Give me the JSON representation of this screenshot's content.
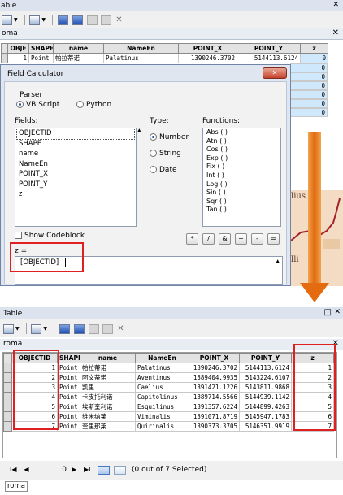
{
  "top_window": {
    "title": "able",
    "toolbar_icons": [
      "table-options-icon",
      "related-tables-icon",
      "select-by-attributes-icon",
      "switch-selection-icon",
      "clear-selection-icon",
      "zoom-to-selected-icon",
      "delete-selected-icon"
    ],
    "tab_label": "oma",
    "close_symbol": "✕",
    "columns": [
      "OBJE",
      "SHAPE",
      "name",
      "NameEn",
      "POINT_X",
      "POINT_Y",
      "z"
    ],
    "first_row": {
      "objectid": "1",
      "shape": "Point",
      "name": "帕拉蒂诺",
      "name_en": "Palatinus",
      "point_x": "1390246.3702",
      "point_y": "5144113.6124",
      "z": "0"
    },
    "z_values": [
      "0",
      "0",
      "0",
      "0",
      "0",
      "0",
      "0"
    ]
  },
  "dialog": {
    "title": "Field Calculator",
    "close_symbol": "✕",
    "parser_label": "Parser",
    "parser_options": [
      "VB Script",
      "Python"
    ],
    "fields_label": "Fields:",
    "fields": [
      "OBJECTID",
      "SHAPE",
      "name",
      "NameEn",
      "POINT_X",
      "POINT_Y",
      "z"
    ],
    "type_label": "Type:",
    "types": [
      "Number",
      "String",
      "Date"
    ],
    "functions_label": "Functions:",
    "functions": [
      "Abs ( )",
      "Atn ( )",
      "Cos ( )",
      "Exp ( )",
      "Fix ( )",
      "Int ( )",
      "Log ( )",
      "Sin ( )",
      "Sqr ( )",
      "Tan ( )"
    ],
    "show_codeblock_label": "Show Codeblock",
    "operators": [
      "*",
      "/",
      "&",
      "+",
      "-",
      "="
    ],
    "expression_label": "z =",
    "expression_value": "[OBJECTID]"
  },
  "map_fragment": {
    "label_1": "lius",
    "label_2": "lli"
  },
  "bottom_window": {
    "title": "Table",
    "window_buttons": [
      "□",
      "✕"
    ],
    "tab_label": "roma",
    "close_symbol": "✕",
    "columns": [
      "OBJECTID",
      "SHAPE",
      "name",
      "NameEn",
      "POINT_X",
      "POINT_Y",
      "z"
    ],
    "rows": [
      {
        "objectid": "1",
        "shape": "Point",
        "name": "帕拉蒂诺",
        "name_en": "Palatinus",
        "point_x": "1390246.3702",
        "point_y": "5144113.6124",
        "z": "1"
      },
      {
        "objectid": "2",
        "shape": "Point",
        "name": "阿文蒂诺",
        "name_en": "Aventinus",
        "point_x": "1389404.9935",
        "point_y": "5143224.6107",
        "z": "2"
      },
      {
        "objectid": "3",
        "shape": "Point",
        "name": "凯里",
        "name_en": "Caelius",
        "point_x": "1391421.1226",
        "point_y": "5143811.9868",
        "z": "3"
      },
      {
        "objectid": "4",
        "shape": "Point",
        "name": "卡皮托利诺",
        "name_en": "Capitolinus",
        "point_x": "1389714.5566",
        "point_y": "5144939.1142",
        "z": "4"
      },
      {
        "objectid": "5",
        "shape": "Point",
        "name": "埃斯奎利诺",
        "name_en": "Esquilinus",
        "point_x": "1391357.6224",
        "point_y": "5144899.4263",
        "z": "5"
      },
      {
        "objectid": "6",
        "shape": "Point",
        "name": "维米纳莱",
        "name_en": "Viminalis",
        "point_x": "1391071.8719",
        "point_y": "5145947.1783",
        "z": "6"
      },
      {
        "objectid": "7",
        "shape": "Point",
        "name": "奎里那莱",
        "name_en": "Quirinalis",
        "point_x": "1390373.3705",
        "point_y": "5146351.9919",
        "z": "7"
      }
    ],
    "nav_first": "I◀",
    "nav_prev": "◀",
    "record_position": "0",
    "nav_next": "▶",
    "nav_last": "▶I",
    "selection_status": "(0 out of 7 Selected)",
    "bottom_tab": "roma"
  },
  "colors": {
    "highlight_red": "#e02020",
    "arrow_orange": "#e56b10",
    "selection_blue": "#cfe8fb"
  }
}
